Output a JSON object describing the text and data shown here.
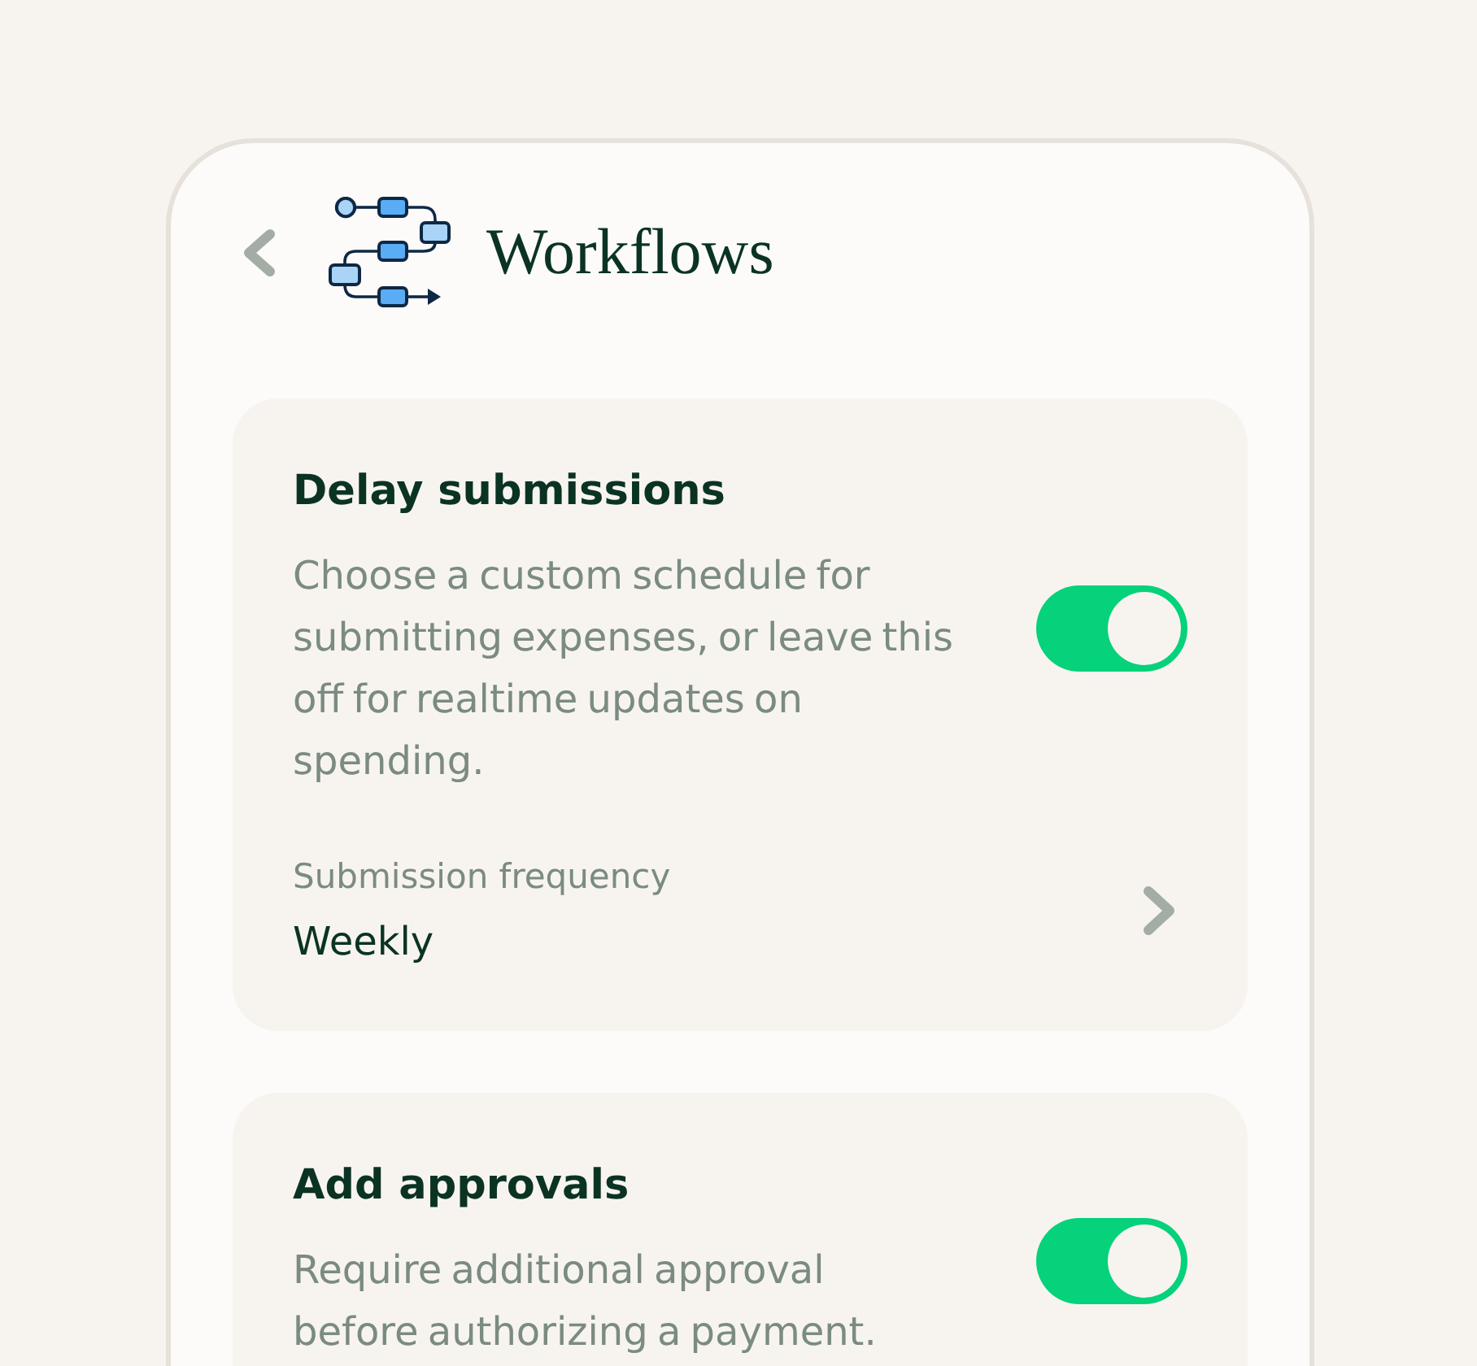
{
  "header": {
    "title": "Workflows"
  },
  "settings": [
    {
      "title": "Delay submissions",
      "description": "Choose a custom schedule for submitting expenses, or leave this off for realtime updates on spending.",
      "on": true,
      "option": {
        "label": "Submission frequency",
        "value": "Weekly"
      }
    },
    {
      "title": "Add approvals",
      "description": "Require additional approval before authorizing a payment.",
      "on": true
    }
  ]
}
